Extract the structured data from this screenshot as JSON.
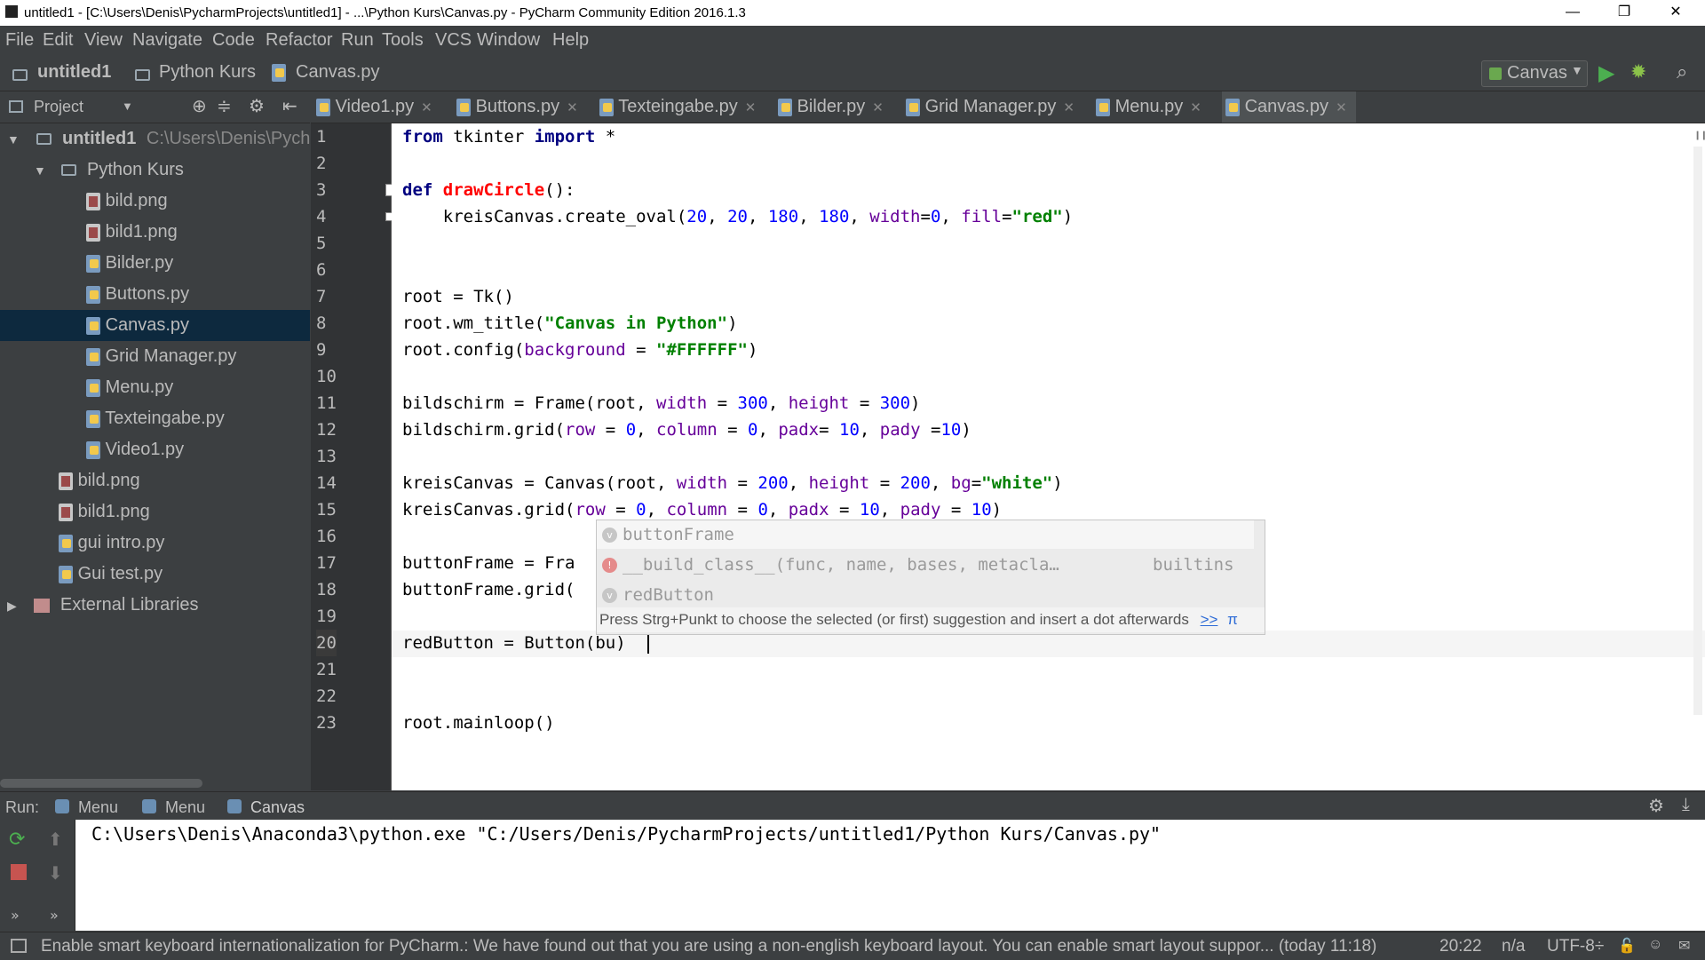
{
  "window": {
    "title": "untitled1 - [C:\\Users\\Denis\\PycharmProjects\\untitled1] - ...\\Python Kurs\\Canvas.py - PyCharm Community Edition 2016.1.3",
    "minimize": "—",
    "maximize": "❐",
    "close": "✕"
  },
  "menu": [
    "File",
    "Edit",
    "View",
    "Navigate",
    "Code",
    "Refactor",
    "Run",
    "Tools",
    "VCS",
    "Window",
    "Help"
  ],
  "breadcrumb": [
    "untitled1",
    "Python Kurs",
    "Canvas.py"
  ],
  "run_config": "Canvas",
  "project_panel": {
    "label": "Project"
  },
  "tabs": [
    "Video1.py",
    "Buttons.py",
    "Texteingabe.py",
    "Bilder.py",
    "Grid Manager.py",
    "Menu.py",
    "Canvas.py"
  ],
  "tree": {
    "root": "untitled1",
    "root_path": "C:\\Users\\Denis\\Pycha",
    "folder": "Python Kurs",
    "folder_items": [
      "bild.png",
      "bild1.png",
      "Bilder.py",
      "Buttons.py",
      "Canvas.py",
      "Grid Manager.py",
      "Menu.py",
      "Texteingabe.py",
      "Video1.py"
    ],
    "root_items": [
      "bild.png",
      "bild1.png",
      "gui intro.py",
      "Gui test.py"
    ],
    "external": "External Libraries"
  },
  "line_numbers": [
    "1",
    "2",
    "3",
    "4",
    "5",
    "6",
    "7",
    "8",
    "9",
    "10",
    "11",
    "12",
    "13",
    "14",
    "15",
    "16",
    "17",
    "18",
    "19",
    "20",
    "21",
    "22",
    "23"
  ],
  "code": {
    "l1_kw1": "from",
    "l1_mod": " tkinter ",
    "l1_kw2": "import",
    "l1_rest": " *",
    "l3_kw": "def",
    "l3_fn": "drawCircle",
    "l3_rest": "():",
    "l4_a": "    kreisCanvas.create_oval(",
    "l4_n1": "20",
    "l4_n2": "20",
    "l4_n3": "180",
    "l4_n4": "180",
    "l4_p1": "width",
    "l4_n5": "0",
    "l4_p2": "fill",
    "l4_s": "\"red\"",
    "l7": "root = Tk()",
    "l8_a": "root.wm_title(",
    "l8_s": "\"Canvas in Python\"",
    "l8_b": ")",
    "l9_a": "root.config(",
    "l9_p": "background",
    "l9_eq": " = ",
    "l9_s": "\"#FFFFFF\"",
    "l9_b": ")",
    "l11_a": "bildschirm = Frame(root, ",
    "l11_p1": "width",
    "l11_eq1": " = ",
    "l11_n1": "300",
    "l11_c": ", ",
    "l11_p2": "height",
    "l11_eq2": " = ",
    "l11_n2": "300",
    "l11_b": ")",
    "l12_a": "bildschirm.grid(",
    "l12_p1": "row",
    "l12_eq1": " = ",
    "l12_n1": "0",
    "l12_c1": ", ",
    "l12_p2": "column",
    "l12_eq2": " = ",
    "l12_n2": "0",
    "l12_c2": ", ",
    "l12_p3": "padx",
    "l12_eq3": "= ",
    "l12_n3": "10",
    "l12_c3": ", ",
    "l12_p4": "pady",
    "l12_eq4": " =",
    "l12_n4": "10",
    "l12_b": ")",
    "l14_a": "kreisCanvas = Canvas(root, ",
    "l14_p1": "width",
    "l14_eq1": " = ",
    "l14_n1": "200",
    "l14_c1": ", ",
    "l14_p2": "height",
    "l14_eq2": " = ",
    "l14_n2": "200",
    "l14_c2": ", ",
    "l14_p3": "bg",
    "l14_eq3": "=",
    "l14_s": "\"white\"",
    "l14_b": ")",
    "l15_a": "kreisCanvas.grid(",
    "l15_p1": "row",
    "l15_eq1": " = ",
    "l15_n1": "0",
    "l15_c1": ", ",
    "l15_p2": "column",
    "l15_eq2": " = ",
    "l15_n2": "0",
    "l15_c2": ", ",
    "l15_p3": "padx",
    "l15_eq3": " = ",
    "l15_n3": "10",
    "l15_c3": ", ",
    "l15_p4": "pady",
    "l15_eq4": " = ",
    "l15_n4": "10",
    "l15_b": ")",
    "l17": "buttonFrame = Fra",
    "l18": "buttonFrame.grid(",
    "l20": "redButton = Button(bu)",
    "l23": "root.mainloop()"
  },
  "completion": {
    "items": [
      {
        "icon": "v",
        "text": "buttonFrame",
        "extra": ""
      },
      {
        "icon": "!",
        "text": "__build_class__(func, name, bases, metacla…",
        "extra": "builtins"
      },
      {
        "icon": "v",
        "text": "redButton",
        "extra": ""
      }
    ],
    "hint": "Press Strg+Punkt to choose the selected (or first) suggestion and insert a dot afterwards",
    "hint_link": ">>",
    "hint_pi": "π"
  },
  "run": {
    "label": "Run:",
    "tabs": [
      "Menu",
      "Menu",
      "Canvas"
    ],
    "command": "C:\\Users\\Denis\\Anaconda3\\python.exe \"C:/Users/Denis/PycharmProjects/untitled1/Python Kurs/Canvas.py\""
  },
  "status": {
    "message": "Enable smart keyboard internationalization for PyCharm.: We have found out that you are using a non-english keyboard layout. You can enable smart layout suppor... (today 11:18)",
    "position": "20:22",
    "na": "n/a",
    "encoding": "UTF-8÷"
  }
}
